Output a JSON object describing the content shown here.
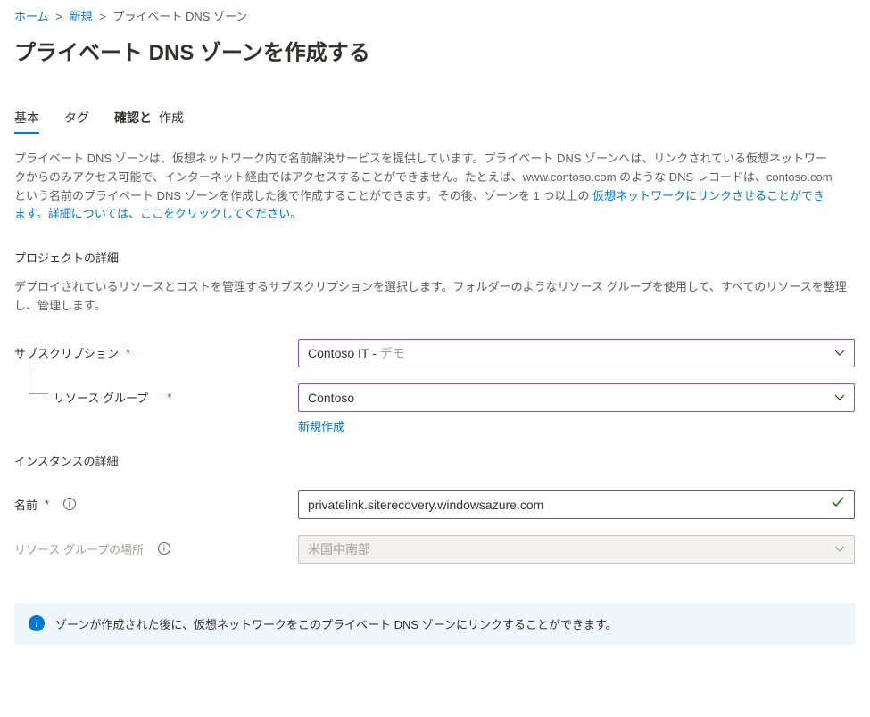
{
  "breadcrumb": {
    "home": "ホーム",
    "new": "新規",
    "current": "プライベート DNS ゾーン"
  },
  "page_title": "プライベート DNS ゾーンを作成する",
  "tabs": {
    "basic": "基本",
    "tags": "タグ",
    "review": "確認と",
    "create": "作成"
  },
  "description": {
    "body": "プライベート DNS ゾーンは、仮想ネットワーク内で名前解決サービスを提供しています。プライベート DNS ゾーンへは、リンクされている仮想ネットワークからのみアクセス可能で、インターネット経由ではアクセスすることができません。たとえば、www.contoso.com のような DNS レコードは、contoso.com という名前のプライベート DNS ゾーンを作成した後で作成することができます。その後、ゾーンを 1 つ以上の",
    "link": "仮想ネットワークにリンクさせることができます。詳細については、ここをクリックしてください。"
  },
  "project": {
    "title": "プロジェクトの詳細",
    "desc": "デプロイされているリソースとコストを管理するサブスクリプションを選択します。フォルダーのようなリソース グループを使用して、すべてのリソースを整理し、管理します。",
    "subscription_label": "サブスクリプション",
    "subscription_value": "Contoso IT -",
    "subscription_hint": "デモ",
    "resource_group_label": "リソース グループ",
    "resource_group_value": "Contoso",
    "create_new": "新規作成"
  },
  "instance": {
    "title": "インスタンスの詳細",
    "name_label": "名前",
    "name_value": "privatelink.siterecovery.windowsazure.com",
    "location_label": "リソース グループの場所",
    "location_value": "米国中南部"
  },
  "banner": {
    "text": "ゾーンが作成された後に、仮想ネットワークをこのプライベート DNS ゾーンにリンクすることができます。"
  }
}
